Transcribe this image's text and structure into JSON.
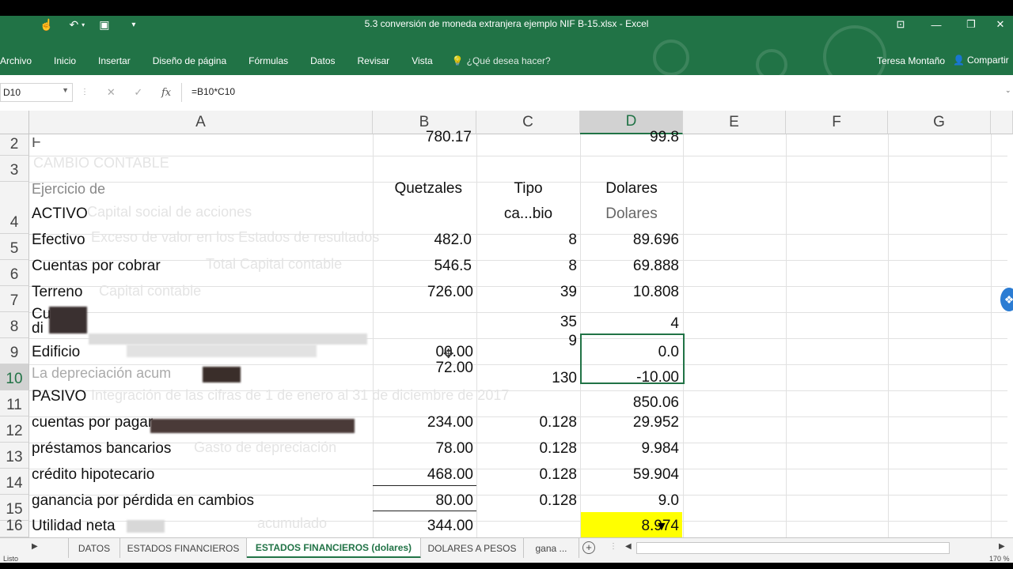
{
  "window": {
    "title": "5.3 conversión de moneda extranjera ejemplo NIF B-15.xlsx - Excel"
  },
  "ribbon": {
    "tabs": [
      "Archivo",
      "Inicio",
      "Insertar",
      "Diseño de página",
      "Fórmulas",
      "Datos",
      "Revisar",
      "Vista"
    ],
    "tell_me": "¿Qué desea hacer?",
    "user": "Teresa Montaño",
    "share": "Compartir"
  },
  "formula_bar": {
    "name_box": "D10",
    "fx_symbol": "fx",
    "formula": "=B10*C10"
  },
  "columns": [
    "A",
    "B",
    "C",
    "D",
    "E",
    "F",
    "G"
  ],
  "rows": [
    "2",
    "3",
    "4",
    "5",
    "6",
    "7",
    "8",
    "9",
    "10",
    "11",
    "12",
    "13",
    "14",
    "15",
    "16"
  ],
  "cells": {
    "r2": {
      "b": "780.17",
      "d": "99.8"
    },
    "r3": {
      "a": "CAMBIO CONTABLE",
      "a2": "Ejercicio de"
    },
    "r4": {
      "a": "ACTIVO",
      "b": "Quetzales",
      "c1": "Tipo",
      "c2": "ca...bio",
      "d1": "Dolares",
      "d2": "Dolares"
    },
    "r5": {
      "a": "Efectivo",
      "b": "482.0",
      "c": "8",
      "d": "89.696"
    },
    "r6": {
      "a": "Cuentas por cobrar",
      "b": "546.5",
      "c": "8",
      "d": "69.888"
    },
    "r7": {
      "a": "Terreno",
      "b": "726.00",
      "c": "39",
      "d": "10.808"
    },
    "r8": {
      "a": "Cu",
      "a2": "di",
      "c": "35",
      "d": "4"
    },
    "r9": {
      "a": "Edificio",
      "b": "00.00",
      "c": "9",
      "d": "0.0"
    },
    "r10": {
      "a": "La depreciación acum",
      "b": "72.00",
      "c": "130",
      "d": "-10.00"
    },
    "r11": {
      "a": "PASIVO",
      "d": "850.06"
    },
    "r12": {
      "a": "cuentas por pagar",
      "b": "234.00",
      "c": "0.128",
      "d": "29.952"
    },
    "r13": {
      "a": "préstamos bancarios",
      "b": "78.00",
      "c": "0.128",
      "d": "9.984"
    },
    "r14": {
      "a": "crédito hipotecario",
      "b": "468.00",
      "c": "0.128",
      "d": "59.904"
    },
    "r15": {
      "a": "ganancia por pérdida en cambios",
      "b": "80.00",
      "c": "0.128",
      "d": "9.0"
    },
    "r16": {
      "a": "Utilidad neta",
      "b": "344.00",
      "d": "8.974"
    }
  },
  "ghost_text": [
    "CAMBIO CONTABLE",
    "Capital social de acciones",
    "Total Capital contable",
    "Capital contable",
    "Exceso de valor en los Estados de resultados",
    "Integración de las cifras de 1 de enero al 31 de diciembre de 2017",
    "Gasto de depreciación",
    "acumulado"
  ],
  "sheets": [
    "DATOS",
    "ESTADOS FINANCIEROS",
    "ESTADOS FINANCIEROS (dolares)",
    "DOLARES A PESOS",
    "gana ..."
  ],
  "status": {
    "left": "Listo",
    "zoom": "170 %"
  },
  "colors": {
    "excel_green": "#217346",
    "highlight": "#ffff00"
  }
}
